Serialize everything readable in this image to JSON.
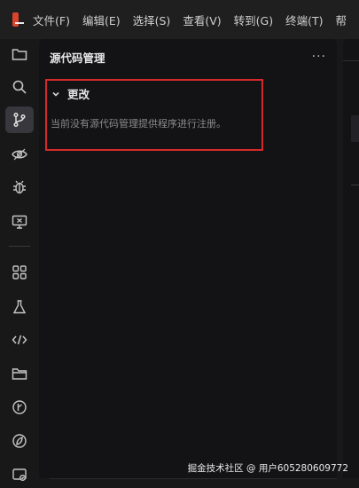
{
  "menubar": {
    "items": [
      "文件(F)",
      "编辑(E)",
      "选择(S)",
      "查看(V)",
      "转到(G)",
      "终端(T)",
      "帮"
    ]
  },
  "activity_bar": {
    "icons": [
      "explorer-icon",
      "search-icon",
      "source-control-icon",
      "preview-icon",
      "debug-icon",
      "remote-screen-icon",
      "extensions-icon",
      "testing-icon",
      "code-icon",
      "folder-icon",
      "timeline-icon",
      "leaf-icon",
      "project-icon"
    ],
    "active": "source-control-icon"
  },
  "sidebar": {
    "title": "源代码管理",
    "more": "···",
    "section": {
      "title": "更改",
      "message": "当前没有源代码管理提供程序进行注册。"
    }
  },
  "watermark": "掘金技术社区 @ 用户605280609772",
  "colors": {
    "highlight_border": "#d62a2a",
    "logo": "#d8442e",
    "active_bg": "#37373d"
  }
}
